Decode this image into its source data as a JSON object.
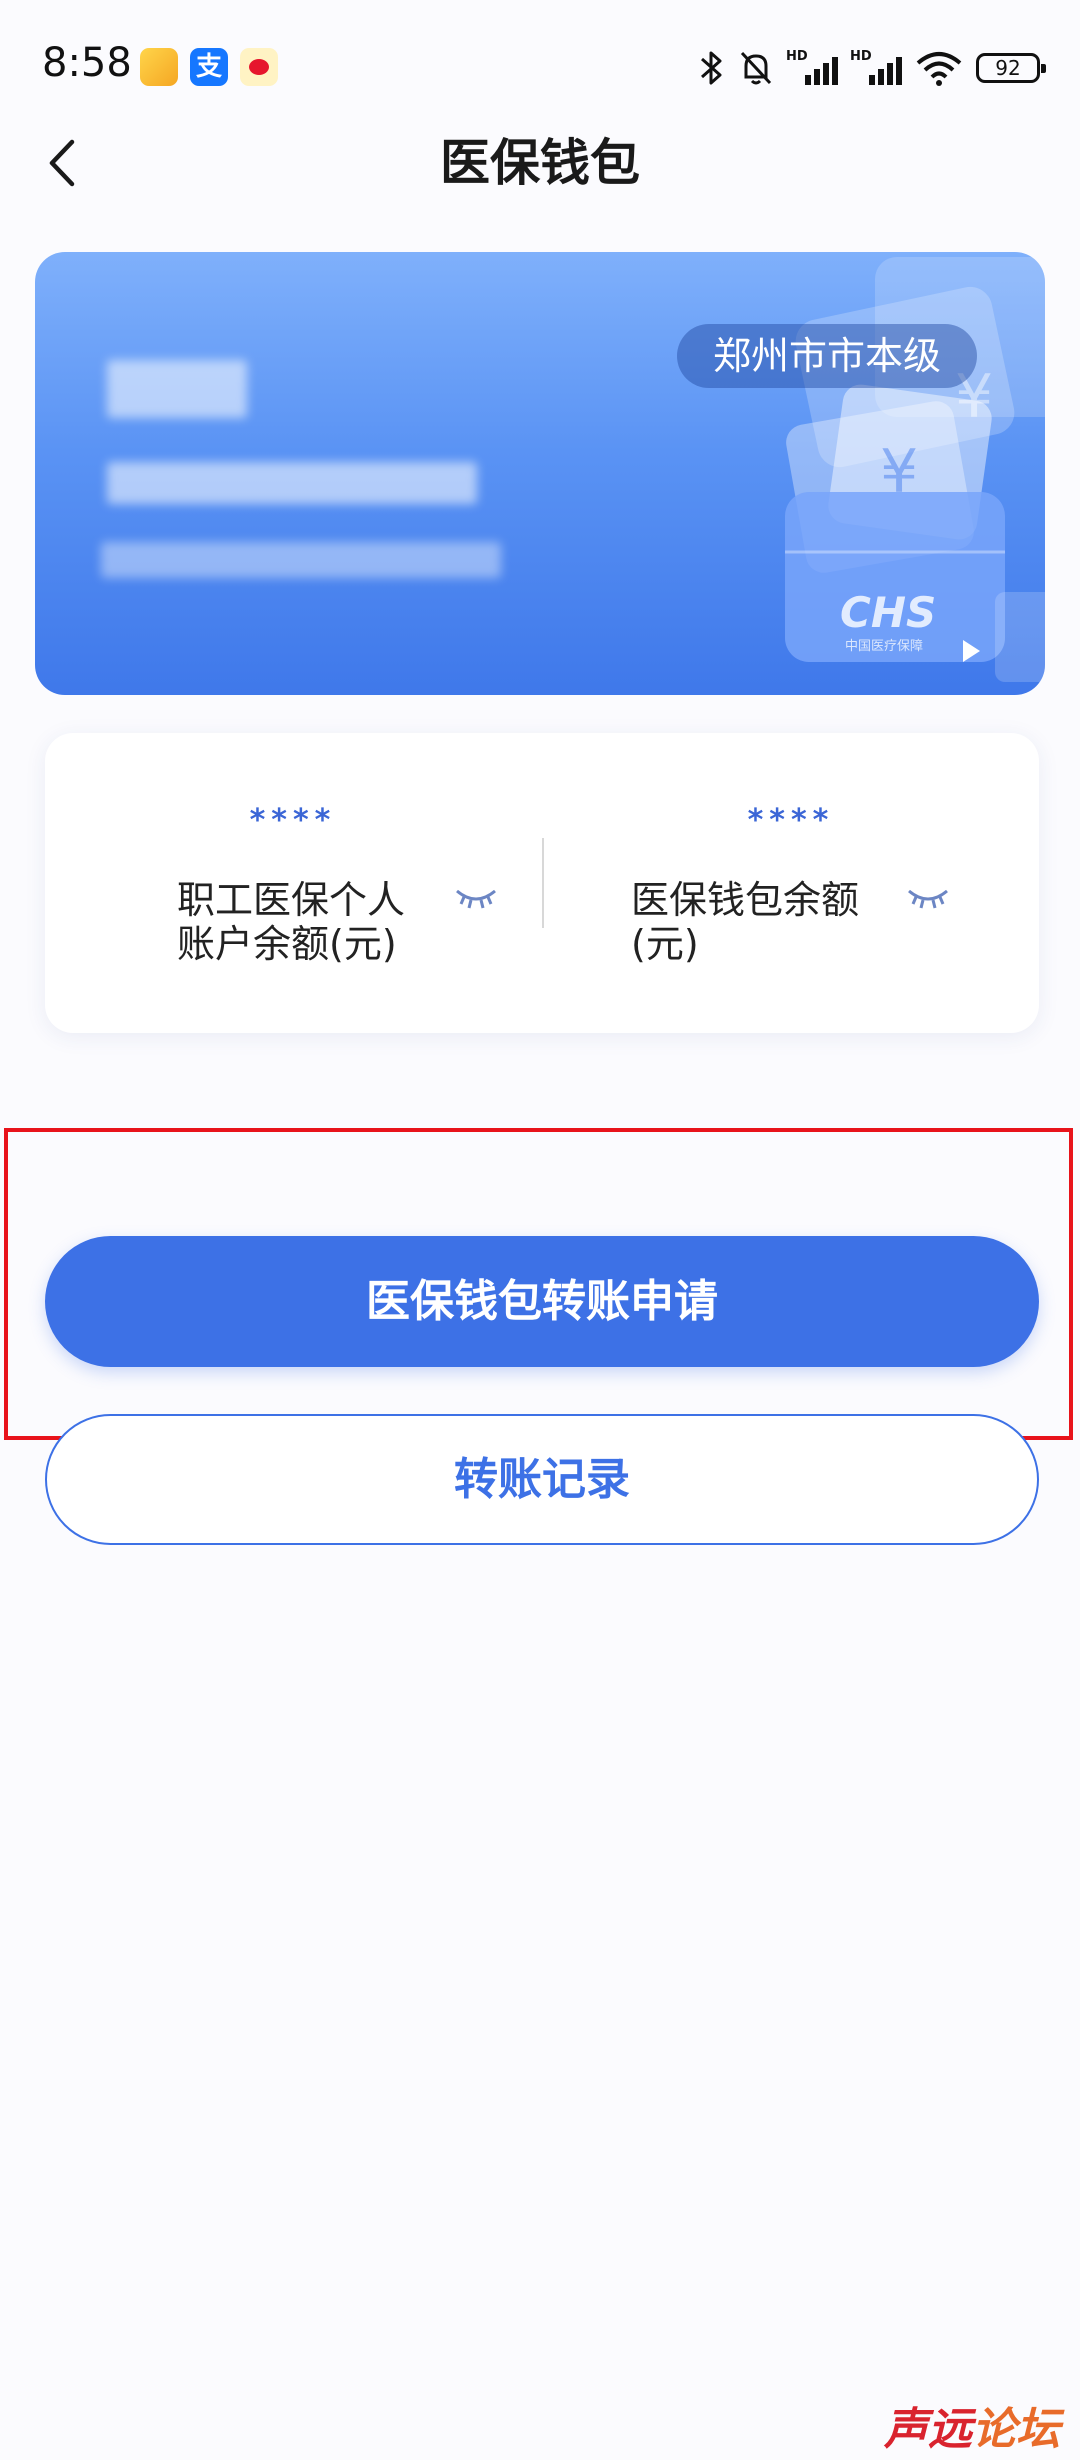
{
  "status_bar": {
    "time": "8:58",
    "apps": [
      "notes-icon",
      "alipay-icon",
      "weibo-icon"
    ],
    "alipay_glyph": "支",
    "signal_label": "HD",
    "battery": "92"
  },
  "header": {
    "title": "医保钱包"
  },
  "card": {
    "region": "郑州市市本级",
    "logo_text": "CHS",
    "logo_subtext": "中国医疗保障"
  },
  "balances": {
    "personal": {
      "masked_value": "****",
      "label": "职工医保个人账户余额(元)"
    },
    "wallet": {
      "masked_value": "****",
      "label": "医保钱包余额(元)"
    }
  },
  "actions": {
    "transfer_apply": "医保钱包转账申请",
    "transfer_records": "转账记录"
  },
  "watermark": {
    "part1": "声远",
    "part2": "论坛"
  },
  "colors": {
    "primary": "#3d71e6",
    "highlight": "#e8131b",
    "card_top": "#7fb0fb",
    "card_bottom": "#3f78ea"
  }
}
